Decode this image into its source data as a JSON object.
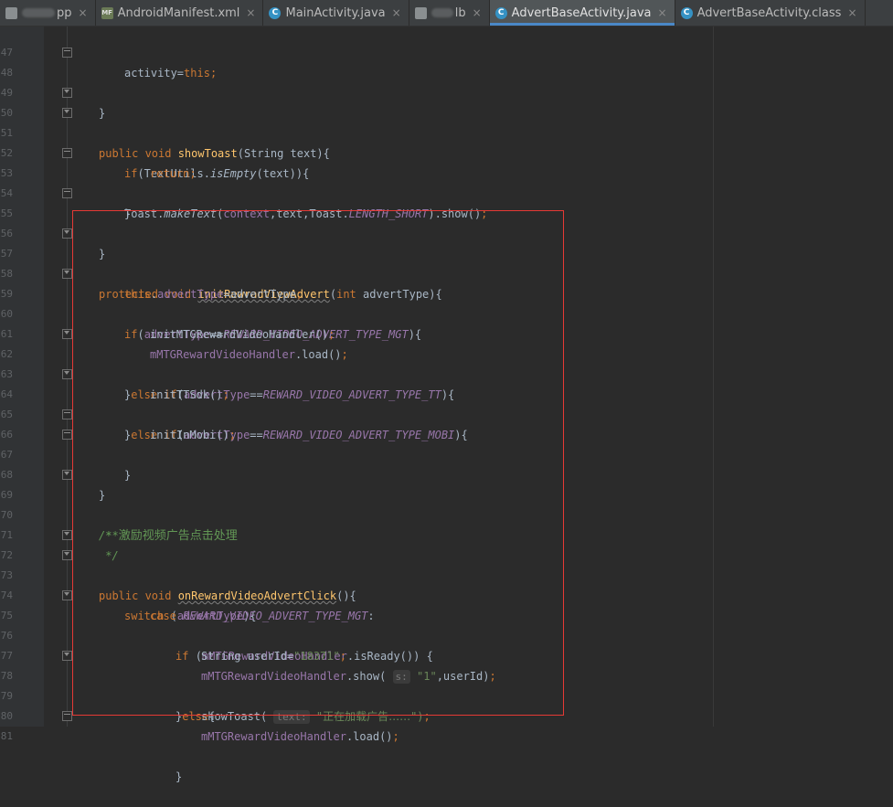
{
  "tabs": [
    {
      "label": "pp",
      "icon": "android-icon",
      "active": false
    },
    {
      "label": "AndroidManifest.xml",
      "icon": "manifest-file-icon",
      "active": false
    },
    {
      "label": "MainActivity.java",
      "icon": "class-c-icon",
      "active": false
    },
    {
      "label": "lb",
      "icon": "gradle-icon",
      "active": false
    },
    {
      "label": "AdvertBaseActivity.java",
      "icon": "class-c-icon",
      "active": true
    },
    {
      "label": "AdvertBaseActivity.class",
      "icon": "class-c-icon",
      "active": false
    }
  ],
  "close_glyph": "×",
  "lines": {
    "l47": {
      "num": "47",
      "a": "activity",
      "b": "=",
      "c": "this",
      "d": ";"
    },
    "l48": {
      "num": "48",
      "a": "}"
    },
    "l49": {
      "num": "49"
    },
    "l50": {
      "num": "50",
      "a": "public void ",
      "b": "showToast",
      "c": "(String text){"
    },
    "l51": {
      "num": "51",
      "a": "if",
      "b": "(TextUtils.",
      "c": "isEmpty",
      "d": "(text)){"
    },
    "l52": {
      "num": "52",
      "a": "return",
      "b": ";"
    },
    "l53": {
      "num": "53",
      "a": "}"
    },
    "l54": {
      "num": "54",
      "a": "Toast.",
      "b": "makeText",
      "c": "(",
      "d": "context",
      "e": ",text,Toast.",
      "f": "LENGTH_SHORT",
      "g": ").show()",
      "h": ";"
    },
    "l55": {
      "num": "55",
      "a": "}"
    },
    "l56": {
      "num": "56"
    },
    "l57": {
      "num": "57",
      "a": "protected void ",
      "b": "initRewradViewAdvert",
      "c": "(",
      "d": "int ",
      "e": "advertType){"
    },
    "l58": {
      "num": "58",
      "a": "this",
      "b": ".",
      "c": "advertType",
      "d": "=advertType",
      "e": ";"
    },
    "l59": {
      "num": "59",
      "a": "if",
      "b": "(",
      "c": "advertType",
      "d": "==",
      "e": "REWARD_VIDEO_ADVERT_TYPE_MGT",
      "f": "){"
    },
    "l60": {
      "num": "60",
      "a": "initMTGRewardVideoHandler()",
      "b": ";"
    },
    "l61": {
      "num": "61",
      "a": "mMTGRewardVideoHandler",
      "b": ".load()",
      "c": ";"
    },
    "l62": {
      "num": "62",
      "a": "}",
      "b": "else if",
      "c": "(",
      "d": "advertType",
      "e": "==",
      "f": "REWARD_VIDEO_ADVERT_TYPE_TT",
      "g": "){"
    },
    "l63": {
      "num": "63",
      "a": "initTTSdk()",
      "b": ";"
    },
    "l64": {
      "num": "64",
      "a": "}",
      "b": "else if",
      "c": "(",
      "d": "advertType",
      "e": "==",
      "f": "REWARD_VIDEO_ADVERT_TYPE_MOBI",
      "g": "){"
    },
    "l65": {
      "num": "65",
      "a": "initInMobi()",
      "b": ";"
    },
    "l66": {
      "num": "66",
      "a": "}"
    },
    "l67": {
      "num": "67",
      "a": "}"
    },
    "l68": {
      "num": "68"
    },
    "l69": {
      "num": "69",
      "a": "/**"
    },
    "l70": {
      "num": "70",
      "a": " * ",
      "b": "激励视频广告点击处理"
    },
    "l71": {
      "num": "71",
      "a": " */"
    },
    "l72": {
      "num": "72",
      "a": "public void ",
      "b": "onRewardVideoAdvertClick",
      "c": "(){"
    },
    "l73": {
      "num": "73",
      "a": "switch ",
      "b": "(",
      "c": "advertType",
      "d": "){"
    },
    "l74": {
      "num": "74",
      "a": "case ",
      "b": "REWARD_VIDEO_ADVERT_TYPE_MGT",
      "c": ":"
    },
    "l75": {
      "num": "75",
      "a": "if ",
      "b": "(",
      "c": "mMTGRewardVideoHandler",
      "d": ".isReady()) {"
    },
    "l76": {
      "num": "76",
      "a": "String userId=",
      "b": "\"18371\"",
      "c": ";"
    },
    "l77": {
      "num": "77",
      "a": "mMTGRewardVideoHandler",
      "b": ".show( ",
      "c": "s:",
      "d": " \"1\"",
      "e": ",userId)",
      "f": ";"
    },
    "l78": {
      "num": "78",
      "a": "}",
      "b": "else",
      "c": "{"
    },
    "l79": {
      "num": "79",
      "a": "showToast( ",
      "b": "text:",
      "c": " \"",
      "d": "正在加载广告……",
      "e": "\")",
      "f": ";"
    },
    "l80": {
      "num": "80",
      "a": "mMTGRewardVideoHandler",
      "b": ".load()",
      "c": ";"
    },
    "l81": {
      "num": "81",
      "a": "}"
    }
  },
  "annotation": {
    "color": "#e53935"
  }
}
